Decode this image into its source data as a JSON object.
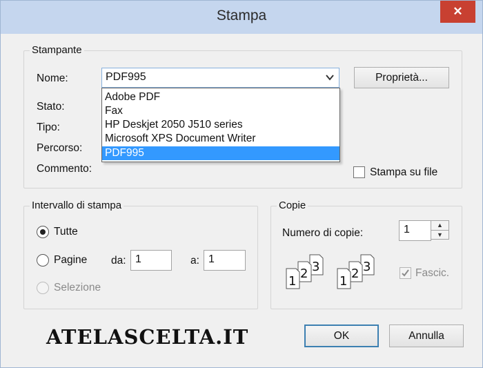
{
  "dialog": {
    "title": "Stampa",
    "close_label": "✕"
  },
  "printer": {
    "legend": "Stampante",
    "name_label": "Nome:",
    "selected": "PDF995",
    "options": [
      "Adobe PDF",
      "Fax",
      "HP Deskjet 2050 J510 series",
      "Microsoft XPS Document Writer",
      "PDF995"
    ],
    "properties_label": "Proprietà...",
    "status_label": "Stato:",
    "type_label": "Tipo:",
    "path_label": "Percorso:",
    "comment_label": "Commento:",
    "print_to_file_label": "Stampa su file",
    "print_to_file_checked": false
  },
  "range": {
    "legend": "Intervallo di stampa",
    "all_label": "Tutte",
    "pages_label": "Pagine",
    "selection_label": "Selezione",
    "selected": "all",
    "from_label": "da:",
    "from_value": "1",
    "to_label": "a:",
    "to_value": "1"
  },
  "copies": {
    "legend": "Copie",
    "count_label": "Numero di copie:",
    "count_value": "1",
    "collate_label": "Fascic.",
    "collate_checked": true,
    "collate_icon_digits": [
      "1",
      "2",
      "3"
    ]
  },
  "buttons": {
    "ok": "OK",
    "cancel": "Annulla"
  },
  "watermark": "ATELASCELTA.IT",
  "colors": {
    "titlebar": "#c5d6ee",
    "close_button": "#c84031",
    "selection_highlight": "#3399ff",
    "default_button_border": "#3c7fb1"
  }
}
